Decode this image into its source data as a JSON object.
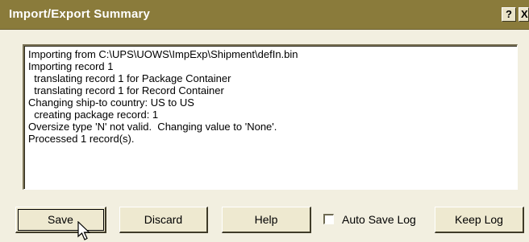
{
  "window": {
    "title": "Import/Export Summary",
    "help_button": "?",
    "close_button": "X"
  },
  "log": {
    "lines": [
      "Importing from C:\\UPS\\UOWS\\ImpExp\\Shipment\\defIn.bin",
      "Importing record 1",
      "  translating record 1 for Package Container",
      "  translating record 1 for Record Container",
      "Changing ship-to country: US to US",
      "  creating package record: 1",
      "Oversize type 'N' not valid.  Changing value to 'None'.",
      "Processed 1 record(s)."
    ]
  },
  "buttons": {
    "save": "Save",
    "discard": "Discard",
    "help": "Help",
    "keep_log": "Keep Log"
  },
  "auto_save_log": {
    "label": "Auto Save Log",
    "checked": false
  },
  "colors": {
    "titlebar": "#8a7b3b",
    "dialog_background": "#f2efe0"
  }
}
